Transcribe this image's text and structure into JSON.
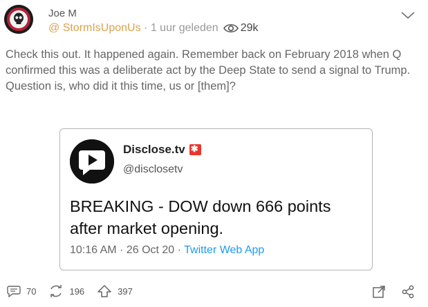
{
  "post": {
    "author_name": "Joe M",
    "handle": "@ StormIsUponUs",
    "time": "1 uur geleden",
    "views": "29k",
    "text": "Check this out. It happened again. Remember back on February 2018 when Q confirmed this was a deliberate act by the Deep State to send a signal to Trump. Question is, who did it this time, us or [them]?"
  },
  "embed": {
    "name": "Disclose.tv",
    "handle": "@disclosetv",
    "text": "BREAKING - DOW down 666 points after market opening.",
    "time": "10:16 AM · 26 Oct 20 · ",
    "source": "Twitter Web App"
  },
  "actions": {
    "comments": "70",
    "reposts": "196",
    "upvotes": "397"
  },
  "icons": {
    "avatar": "skull-flag-avatar",
    "menu": "chevron-down-icon",
    "views": "eye-icon",
    "embed_logo": "play-bubble-logo",
    "comment": "comment-icon",
    "repost": "repost-icon",
    "upvote": "upvote-arrow-icon",
    "expand": "expand-icon",
    "share": "share-icon"
  },
  "colors": {
    "handle": "#d9a24a",
    "link": "#1d9bf0",
    "siren": "#e8362e"
  }
}
